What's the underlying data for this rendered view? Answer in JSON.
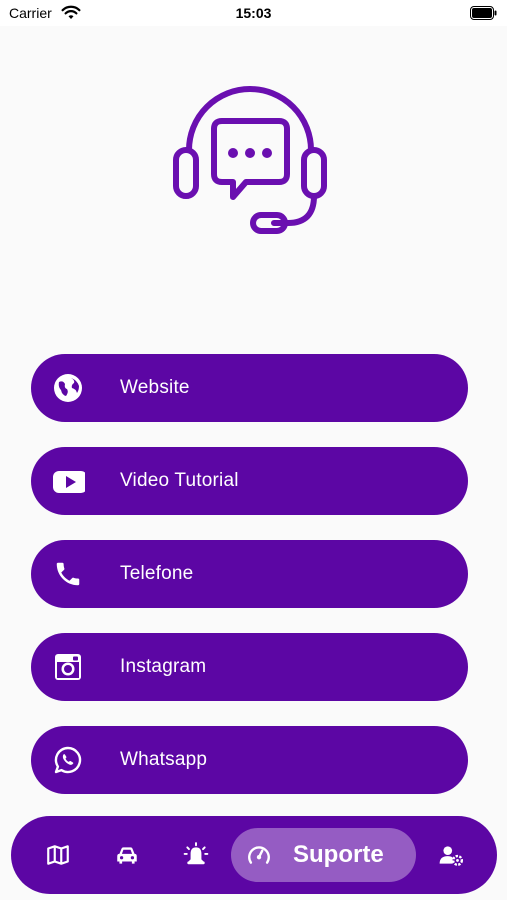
{
  "status_bar": {
    "carrier": "Carrier",
    "time": "15:03"
  },
  "menu": [
    {
      "label": "Website",
      "icon": "globe-icon"
    },
    {
      "label": "Video Tutorial",
      "icon": "youtube-icon"
    },
    {
      "label": "Telefone",
      "icon": "phone-icon"
    },
    {
      "label": "Instagram",
      "icon": "instagram-icon"
    },
    {
      "label": "Whatsapp",
      "icon": "whatsapp-icon"
    }
  ],
  "bottom_nav": {
    "items": [
      "map-icon",
      "car-icon",
      "alarm-icon",
      "gauge-icon",
      "user-settings-icon"
    ],
    "active_label": "Suporte"
  },
  "colors": {
    "primary": "#5c06a4",
    "hero": "#6a0fb0",
    "background": "#fafafa"
  }
}
